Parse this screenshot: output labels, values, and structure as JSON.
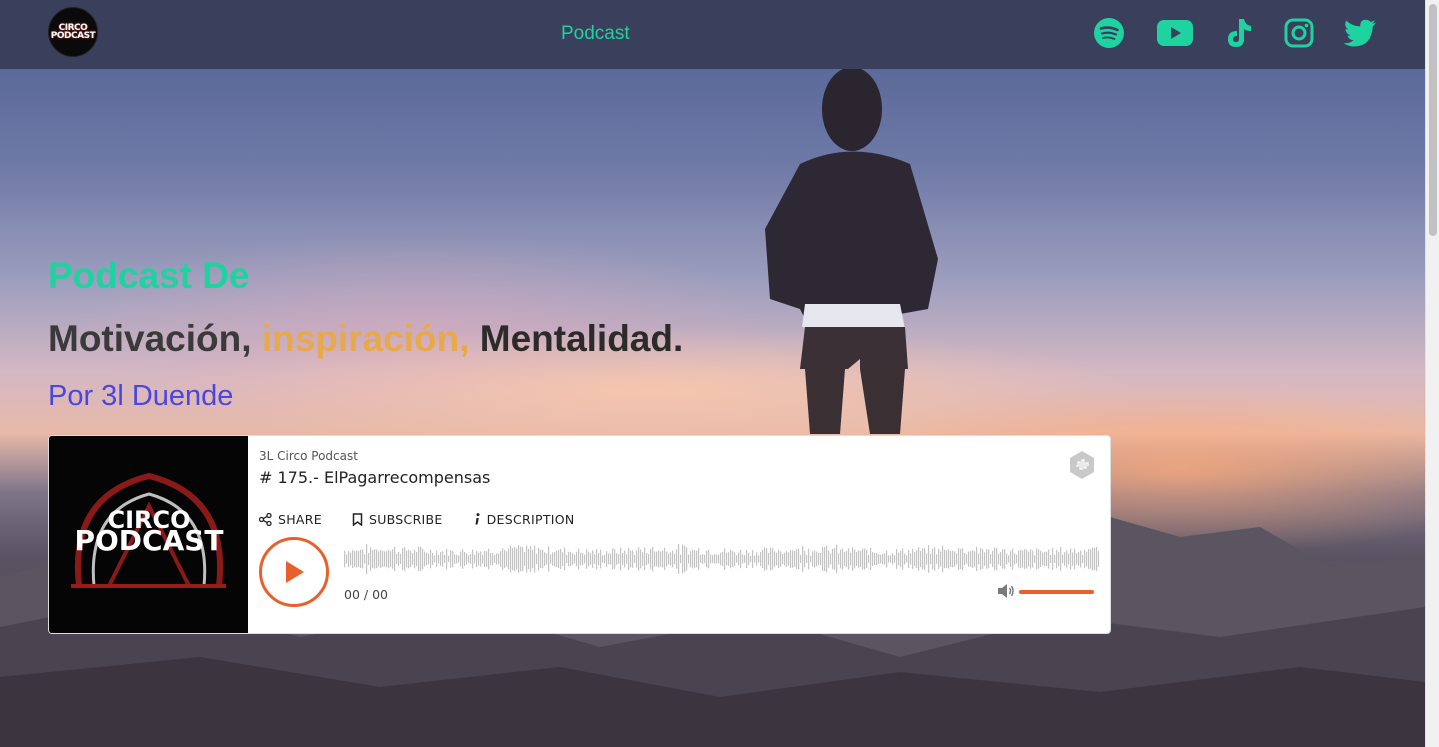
{
  "nav": {
    "logo_text_1": "CIRCO",
    "logo_text_2": "PODCAST",
    "title": "Podcast",
    "social": [
      "spotify-icon",
      "youtube-icon",
      "tiktok-icon",
      "instagram-icon",
      "twitter-icon"
    ]
  },
  "hero": {
    "heading": "Podcast De",
    "tagline_1": "Motivación,",
    "tagline_2": "inspiración,",
    "tagline_3": "Mentalidad.",
    "byline": "Por 3l Duende"
  },
  "player": {
    "cover_text_1": "CIRCO",
    "cover_text_2": "PODCAST",
    "show_name": "3L Circo Podcast",
    "episode_title": "# 175.- ElPagarrecompensas",
    "share_label": "SHARE",
    "subscribe_label": "SUBSCRIBE",
    "description_label": "DESCRIPTION",
    "time": "00 / 00",
    "volume_level": 1.0
  },
  "colors": {
    "accent": "#1ed3a0",
    "orange": "#e8602c",
    "navbar": "#3a3f5c",
    "byline": "#4a46e0",
    "tagline_highlight": "#e8a94a"
  }
}
